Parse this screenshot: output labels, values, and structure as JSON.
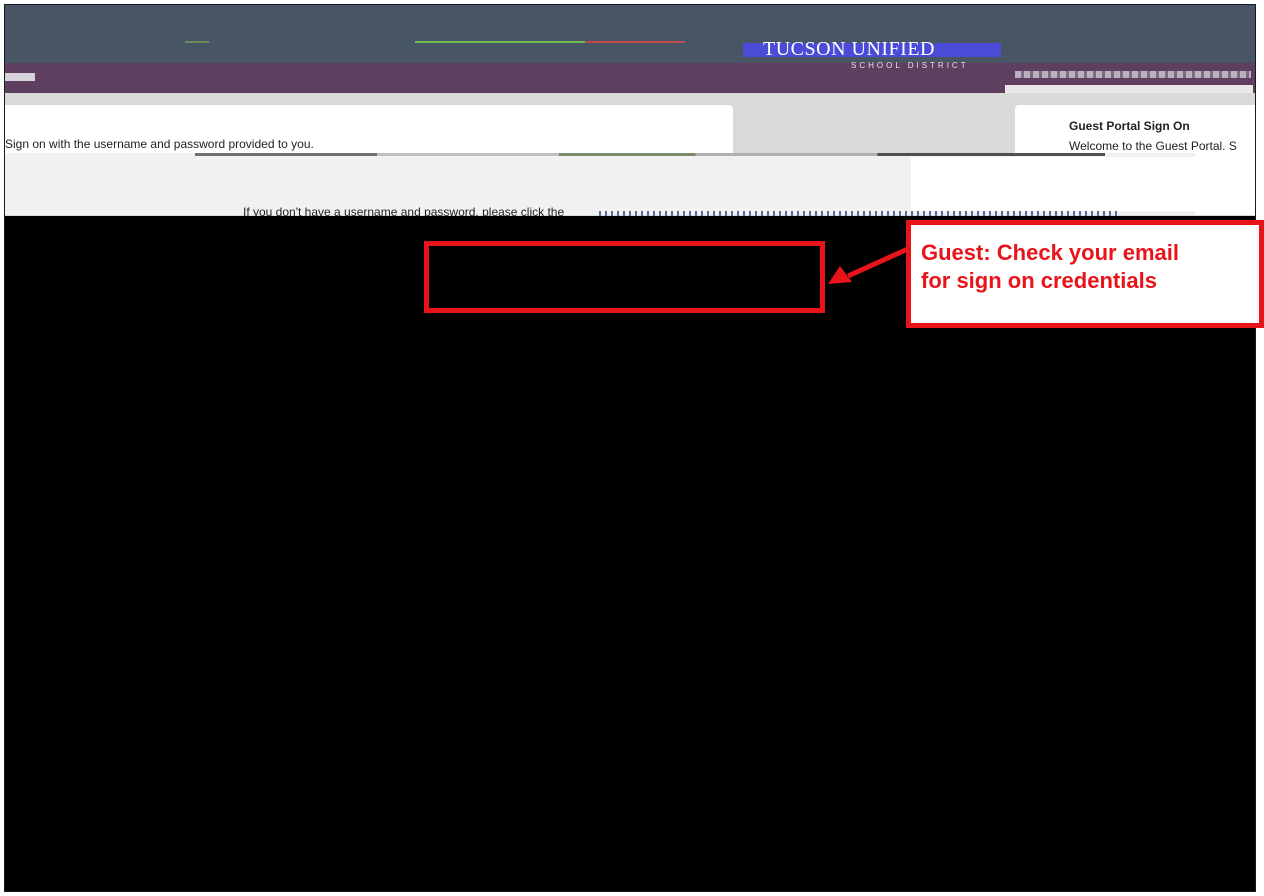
{
  "header": {
    "logo_main": "TUCSON UNIFIED",
    "logo_sub": "SCHOOL DISTRICT"
  },
  "sign_on": {
    "instruction": "Sign on with the username and password provided to you."
  },
  "guest_panel": {
    "title": "Guest Portal Sign On",
    "welcome": "Welcome to the Guest Portal. S"
  },
  "guest_note": "If you don't have a username and password, please click the",
  "callout": {
    "line1": "Guest: Check your email",
    "line2": "for sign on credentials"
  },
  "colors": {
    "annotation_red": "#e8141a",
    "header_bg": "#475564",
    "nav_bg": "#5f3f5f"
  },
  "icons": [
    "arrow-icon"
  ]
}
